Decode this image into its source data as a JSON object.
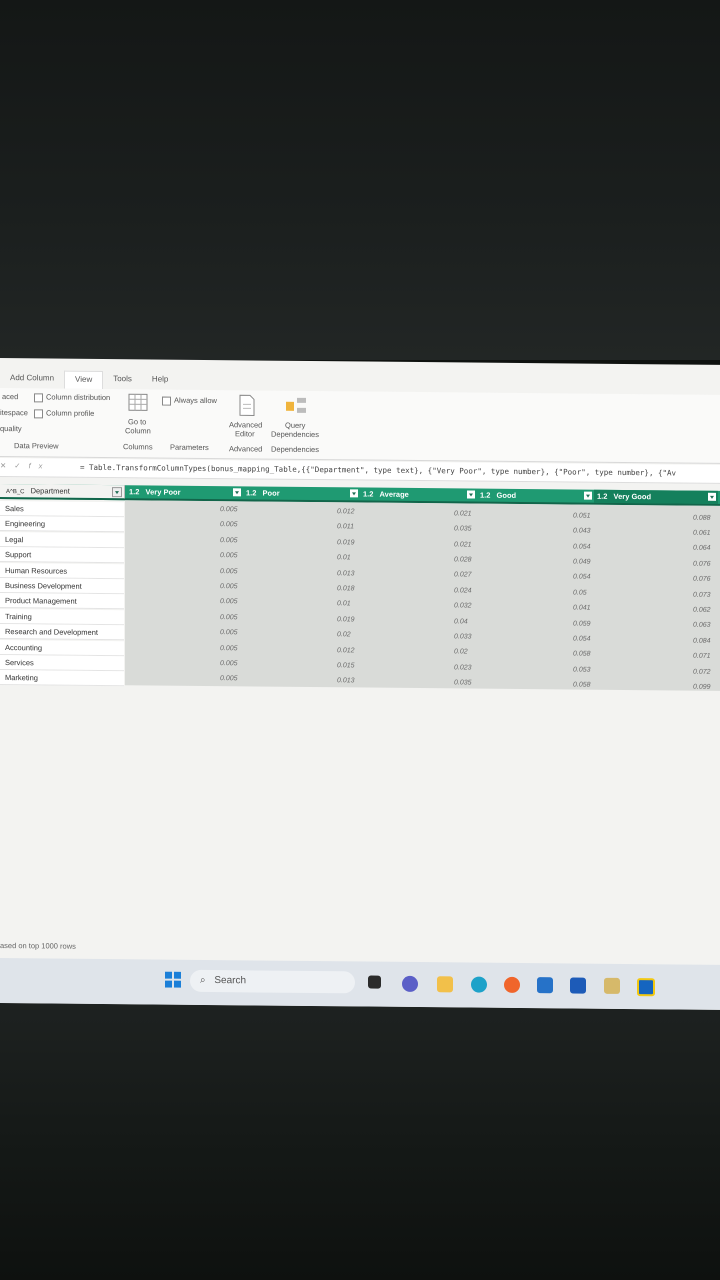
{
  "ribbon": {
    "tabs": [
      {
        "label": "Add Column",
        "active": false
      },
      {
        "label": "View",
        "active": true
      },
      {
        "label": "Tools",
        "active": false
      },
      {
        "label": "Help",
        "active": false
      }
    ],
    "layout_items": [
      "aced",
      "itespace",
      "quality"
    ],
    "checkboxes": {
      "column_distribution": "Column distribution",
      "column_profile": "Column profile",
      "always_allow": "Always allow"
    },
    "group_data_preview": "Data Preview",
    "go_to_column_1": "Go to",
    "go_to_column_2": "Column",
    "group_columns": "Columns",
    "group_parameters": "Parameters",
    "advanced_editor_1": "Advanced",
    "advanced_editor_2": "Editor",
    "group_advanced": "Advanced",
    "query_dep_1": "Query",
    "query_dep_2": "Dependencies",
    "group_dependencies": "Dependencies"
  },
  "formula": {
    "text": "= Table.TransformColumnTypes(bonus_mapping_Table,{{\"Department\", type text}, {\"Very Poor\", type number}, {\"Poor\", type number}, {\"Av"
  },
  "table": {
    "headers": [
      {
        "type": "A^B_C",
        "label": "Department"
      },
      {
        "type": "1.2",
        "label": "Very Poor"
      },
      {
        "type": "1.2",
        "label": "Poor"
      },
      {
        "type": "1.2",
        "label": "Average"
      },
      {
        "type": "1.2",
        "label": "Good"
      },
      {
        "type": "1.2",
        "label": "Very Good"
      }
    ],
    "rows": [
      {
        "dept": "Sales",
        "vals": [
          "0.005",
          "0.012",
          "0.021",
          "0.051",
          "0.088"
        ]
      },
      {
        "dept": "Engineering",
        "vals": [
          "0.005",
          "0.011",
          "0.035",
          "0.043",
          "0.061"
        ]
      },
      {
        "dept": "Legal",
        "vals": [
          "0.005",
          "0.019",
          "0.021",
          "0.054",
          "0.064"
        ]
      },
      {
        "dept": "Support",
        "vals": [
          "0.005",
          "0.01",
          "0.028",
          "0.049",
          "0.076"
        ]
      },
      {
        "dept": "Human Resources",
        "vals": [
          "0.005",
          "0.013",
          "0.027",
          "0.054",
          "0.076"
        ]
      },
      {
        "dept": "Business Development",
        "vals": [
          "0.005",
          "0.018",
          "0.024",
          "0.05",
          "0.073"
        ]
      },
      {
        "dept": "Product Management",
        "vals": [
          "0.005",
          "0.01",
          "0.032",
          "0.041",
          "0.062"
        ]
      },
      {
        "dept": "Training",
        "vals": [
          "0.005",
          "0.019",
          "0.04",
          "0.059",
          "0.063"
        ]
      },
      {
        "dept": "Research and Development",
        "vals": [
          "0.005",
          "0.02",
          "0.033",
          "0.054",
          "0.084"
        ]
      },
      {
        "dept": "Accounting",
        "vals": [
          "0.005",
          "0.012",
          "0.02",
          "0.058",
          "0.071"
        ]
      },
      {
        "dept": "Services",
        "vals": [
          "0.005",
          "0.015",
          "0.023",
          "0.053",
          "0.072"
        ]
      },
      {
        "dept": "Marketing",
        "vals": [
          "0.005",
          "0.013",
          "0.035",
          "0.058",
          "0.099"
        ]
      }
    ]
  },
  "status": "ased on top 1000 rows",
  "taskbar": {
    "search_label": "Search",
    "icons": [
      "windows-start-icon",
      "search-icon",
      "task-view-icon",
      "teams-chat-icon",
      "file-explorer-icon",
      "edge-icon",
      "firefox-icon",
      "store-icon",
      "word-icon",
      "snipping-tool-icon",
      "power-bi-icon"
    ]
  },
  "colors": {
    "header_green": "#1f9a72",
    "screen_bg": "#f3f3f1"
  }
}
